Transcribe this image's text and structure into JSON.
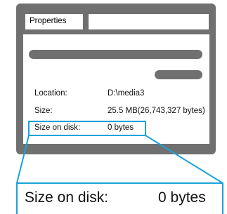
{
  "window": {
    "tab_label": "Properties"
  },
  "properties": [
    {
      "label": "Location:",
      "value": "D:\\media3"
    },
    {
      "label": "Size:",
      "value": "25.5 MB(26,743,327 bytes)"
    },
    {
      "label": "Size on disk:",
      "value": "0 bytes"
    }
  ],
  "zoom": {
    "label": "Size on disk:",
    "value": "0 bytes"
  },
  "colors": {
    "window": "#707070",
    "highlight": "#1aa3d9"
  }
}
